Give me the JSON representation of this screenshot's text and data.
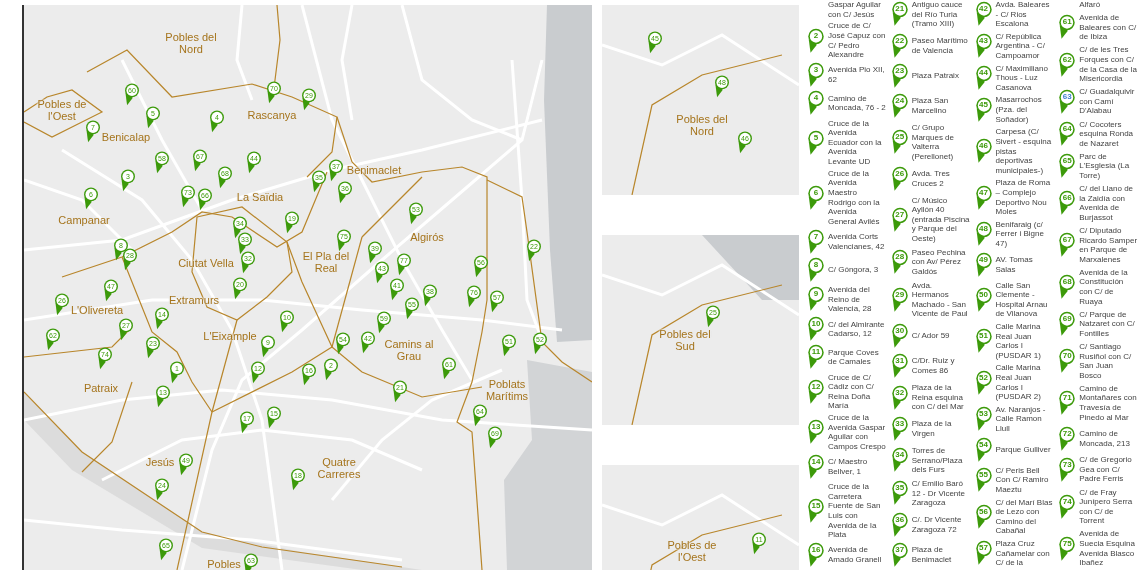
{
  "main_map": {
    "districts": [
      "Pobles del Nord",
      "Pobles de l'Oest",
      "Benicalap",
      "Rascanya",
      "Benimaclet",
      "La Saïdia",
      "Campanar",
      "Algirós",
      "Ciutat Vella",
      "El Pla del Real",
      "Extramurs",
      "L'Olivereta",
      "L'Eixample",
      "Camins al Grau",
      "Patraix",
      "Poblats Marítims",
      "Jesús",
      "Quatre Carreres",
      "Pobles"
    ],
    "markers": [
      "60",
      "5",
      "4",
      "70",
      "29",
      "7",
      "58",
      "67",
      "44",
      "37",
      "35",
      "3",
      "68",
      "36",
      "6",
      "73",
      "66",
      "53",
      "19",
      "34",
      "33",
      "75",
      "8",
      "28",
      "39",
      "22",
      "77",
      "32",
      "43",
      "56",
      "47",
      "20",
      "41",
      "38",
      "76",
      "57",
      "26",
      "55",
      "14",
      "10",
      "59",
      "27",
      "62",
      "23",
      "9",
      "54",
      "42",
      "51",
      "52",
      "12",
      "74",
      "61",
      "16",
      "2",
      "1",
      "13",
      "21",
      "64",
      "17",
      "15",
      "69",
      "49",
      "18",
      "24",
      "65",
      "63"
    ]
  },
  "insets": [
    {
      "district": "Pobles del Nord",
      "markers": [
        "45",
        "48",
        "46"
      ]
    },
    {
      "district": "Pobles del Sud",
      "markers": [
        "25"
      ]
    },
    {
      "district": "Pobles de l'Oest",
      "markers": [
        "11"
      ]
    }
  ],
  "legend": {
    "columns": [
      [
        {
          "text": "Gaspar Aguilar con C/ Jesús"
        },
        {
          "number": "2",
          "text": "Cruce de C/ José Capuz con C/ Pedro Alexandre",
          "color": "#3c9a0a"
        },
        {
          "number": "3",
          "text": "Avenida Pio XII, 62",
          "color": "#3c9a0a"
        },
        {
          "number": "4",
          "text": "Camino de Moncada, 76 - 2",
          "color": "#3c9a0a"
        },
        {
          "number": "5",
          "text": "Cruce de la Avenida Ecuador con la Avenida Levante UD",
          "color": "#3c9a0a"
        },
        {
          "number": "6",
          "text": "Cruce de la Avenida Maestro Rodrigo con la Avenida General Avilés",
          "color": "#3c9a0a"
        },
        {
          "number": "7",
          "text": "Avenida Corts Valencianes, 42",
          "color": "#3c9a0a"
        },
        {
          "number": "8",
          "text": "C/ Góngora, 3",
          "color": "#3c9a0a"
        },
        {
          "number": "9",
          "text": "Avenida del Reino de Valencia, 28",
          "color": "#3c9a0a"
        },
        {
          "number": "10",
          "text": "C/ del Almirante Cadarso, 12",
          "color": "#3c9a0a"
        },
        {
          "number": "11",
          "text": "Parque Coves de Camales",
          "color": "#3c9a0a"
        },
        {
          "number": "12",
          "text": "Cruce de C/ Cádiz con C/ Reina Doña María",
          "color": "#3c9a0a"
        },
        {
          "number": "13",
          "text": "Cruce de la Avenida Gaspar Aguilar con Campos Crespo",
          "color": "#3c9a0a"
        },
        {
          "number": "14",
          "text": "C/ Maestro Bellver, 1",
          "color": "#3c9a0a"
        },
        {
          "number": "15",
          "text": "Cruce de la Carretera Fuente de San Luis con Avenida de la Plata",
          "color": "#3c9a0a"
        },
        {
          "number": "16",
          "text": "Avenida de Amado Granell",
          "color": "#3c9a0a"
        }
      ],
      [
        {
          "number": "21",
          "text": "Antiguo cauce del Río Turia (Tramo XIII)",
          "color": "#3c9a0a"
        },
        {
          "number": "22",
          "text": "Paseo Marítimo de Valencia",
          "color": "#3c9a0a"
        },
        {
          "number": "23",
          "text": "Plaza Patraix",
          "color": "#3c9a0a"
        },
        {
          "number": "24",
          "text": "Plaza San Marcelino",
          "color": "#3c9a0a"
        },
        {
          "number": "25",
          "text": "C/ Grupo Marques de Valterra (Perellonet)",
          "color": "#3c9a0a"
        },
        {
          "number": "26",
          "text": "Avda. Tres Cruces 2",
          "color": "#3c9a0a"
        },
        {
          "number": "27",
          "text": "C/ Músico Ayllón 40 (entrada Piscina y Parque del Oeste)",
          "color": "#3c9a0a"
        },
        {
          "number": "28",
          "text": "Paseo Pechina con Av/ Pérez Galdós",
          "color": "#3c9a0a"
        },
        {
          "number": "29",
          "text": "Avda. Hermanos Machado - San Vicente de Paul",
          "color": "#3c9a0a"
        },
        {
          "number": "30",
          "text": "C/ Ador 59",
          "color": "#3c9a0a"
        },
        {
          "number": "31",
          "text": "C/Dr. Ruiz y Comes 86",
          "color": "#3c9a0a"
        },
        {
          "number": "32",
          "text": "Plaza de la Reina esquina con C/ del Mar",
          "color": "#3c9a0a"
        },
        {
          "number": "33",
          "text": "Plaza de la Virgen",
          "color": "#3c9a0a"
        },
        {
          "number": "34",
          "text": "Torres de Serrano/Plaza dels Furs",
          "color": "#3c9a0a"
        },
        {
          "number": "35",
          "text": "C/ Emilio Baró 12 - Dr Vicente Zaragoza",
          "color": "#3c9a0a"
        },
        {
          "number": "36",
          "text": "C/. Dr Vicente Zaragoza 72",
          "color": "#3c9a0a"
        },
        {
          "number": "37",
          "text": "Plaza de Benimaclet",
          "color": "#3c9a0a"
        }
      ],
      [
        {
          "number": "42",
          "text": "Avda. Baleares - C/ Rios Escalona",
          "color": "#3c9a0a"
        },
        {
          "number": "43",
          "text": "C/ República Argentina - C/ Campoamor",
          "color": "#3c9a0a"
        },
        {
          "number": "44",
          "text": "C/ Maximiliano Thous - Luz Casanova",
          "color": "#3c9a0a"
        },
        {
          "number": "45",
          "text": "Masarrochos (Pza. del Soñador)",
          "color": "#3c9a0a"
        },
        {
          "number": "46",
          "text": "Carpesa (C/ Sivert - esquina pistas deportivas municipales-)",
          "color": "#3c9a0a"
        },
        {
          "number": "47",
          "text": "Plaza de Roma – Complejo Deportivo Nou Moles",
          "color": "#3c9a0a"
        },
        {
          "number": "48",
          "text": "Benifaraig (c/ Ferrer i Bigne 47)",
          "color": "#3c9a0a"
        },
        {
          "number": "49",
          "text": "AV. Tomas Salas",
          "color": "#3c9a0a"
        },
        {
          "number": "50",
          "text": "Calle San Clemente - Hospital Arnau de Vilanova",
          "color": "#3c9a0a"
        },
        {
          "number": "51",
          "text": "Calle Marina Real Juan Carlos I (PUSDAR 1)",
          "color": "#3c9a0a"
        },
        {
          "number": "52",
          "text": "Calle Marina Real Juan Carlos I (PUSDAR 2)",
          "color": "#3c9a0a"
        },
        {
          "number": "53",
          "text": "Av. Naranjos - Calle Ramon Llull",
          "color": "#3c9a0a"
        },
        {
          "number": "54",
          "text": "Parque Gulliver",
          "color": "#3c9a0a"
        },
        {
          "number": "55",
          "text": "C/ Peris Bell Con C/ Ramiro Maeztu",
          "color": "#3c9a0a"
        },
        {
          "number": "56",
          "text": "C/ del Marí Blas de Lezo con Camino del Cabañal",
          "color": "#3c9a0a"
        },
        {
          "number": "57",
          "text": "Plaza Cruz Cañamelar con C/ de la",
          "color": "#3c9a0a"
        }
      ],
      [
        {
          "text": "Alfaró"
        },
        {
          "number": "61",
          "text": "Avenida de Baleares con C/ de Ibiza",
          "color": "#3c9a0a"
        },
        {
          "number": "62",
          "text": "C/ de les Tres Forques con C/ de la Casa de la Misericordia",
          "color": "#3c9a0a"
        },
        {
          "number": "63",
          "text": "C/ Guadalquivir con Camí D'Alabau",
          "color": "#3f7fcf"
        },
        {
          "number": "64",
          "text": "C/ Cocoters esquina Ronda de Nazaret",
          "color": "#3c9a0a"
        },
        {
          "number": "65",
          "text": "Parc de L'Esglesia (La Torre)",
          "color": "#3c9a0a"
        },
        {
          "number": "66",
          "text": "C/ del Llano de la Zaidía con Avenida de Burjassot",
          "color": "#3c9a0a"
        },
        {
          "number": "67",
          "text": "C/ Diputado Ricardo Samper en Parque de Marxalenes",
          "color": "#3c9a0a"
        },
        {
          "number": "68",
          "text": "Avenida de la Constitución con C/ de Ruaya",
          "color": "#3c9a0a"
        },
        {
          "number": "69",
          "text": "C/ Parque de Natzaret con C/ Fontilles",
          "color": "#3c9a0a"
        },
        {
          "number": "70",
          "text": "C/ Santiago Rusiñol con C/ San Juan Bosco",
          "color": "#3c9a0a"
        },
        {
          "number": "71",
          "text": "Camino de Montañares con Travesía de Pinedo al Mar",
          "color": "#3c9a0a"
        },
        {
          "number": "72",
          "text": "Camino de Moncada, 213",
          "color": "#3c9a0a"
        },
        {
          "number": "73",
          "text": "C/ de Gregorio Gea con C/ Padre Ferris",
          "color": "#3c9a0a"
        },
        {
          "number": "74",
          "text": "C/ de Fray Junípero Serra con C/ de Torrent",
          "color": "#3c9a0a"
        },
        {
          "number": "75",
          "text": "Avenida de Suecia Esquina Avenida Blasco Ibañez",
          "color": "#3c9a0a"
        }
      ]
    ]
  }
}
